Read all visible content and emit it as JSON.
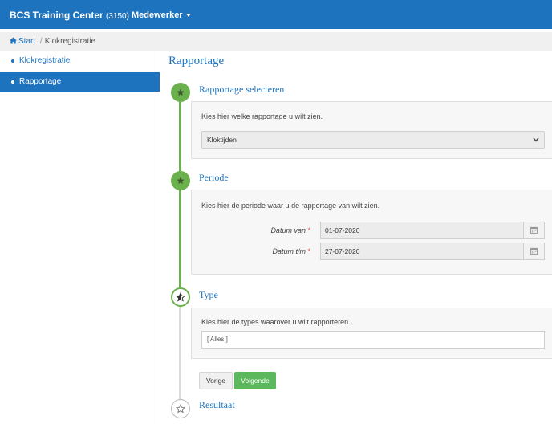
{
  "navbar": {
    "brand": "BCS Training Center",
    "brand_code": "(3150)",
    "user_menu": "Medewerker"
  },
  "breadcrumb": {
    "home": "Start",
    "separator": "/",
    "current": "Klokregistratie"
  },
  "sidebar": {
    "items": [
      {
        "label": "Klokregistratie",
        "active": false
      },
      {
        "label": "Rapportage",
        "active": true
      }
    ]
  },
  "main": {
    "title": "Rapportage",
    "steps": [
      {
        "title": "Rapportage selecteren",
        "state": "done",
        "description": "Kies hier welke rapportage u wilt zien.",
        "select_value": "Kloktijden"
      },
      {
        "title": "Periode",
        "state": "done",
        "description": "Kies hier de periode waar u de rapportage van wilt zien.",
        "fields": [
          {
            "label": "Datum van",
            "required_mark": "*",
            "value": "01-07-2020"
          },
          {
            "label": "Datum t/m",
            "required_mark": "*",
            "value": "27-07-2020"
          }
        ]
      },
      {
        "title": "Type",
        "state": "current",
        "description": "Kies hier de types waarover u wilt rapporteren.",
        "input_value": "[ Alles ]"
      },
      {
        "title": "Resultaat",
        "state": "todo"
      }
    ],
    "buttons": {
      "previous": "Vorige",
      "next": "Volgende"
    }
  },
  "colors": {
    "primary": "#1e73be",
    "success": "#6ab04c",
    "button_success": "#5cb85c",
    "required": "#d9534f"
  },
  "icons": {
    "home": "home-icon",
    "star": "star-icon",
    "calendar": "calendar-icon",
    "chevron": "chevron-down-icon"
  }
}
